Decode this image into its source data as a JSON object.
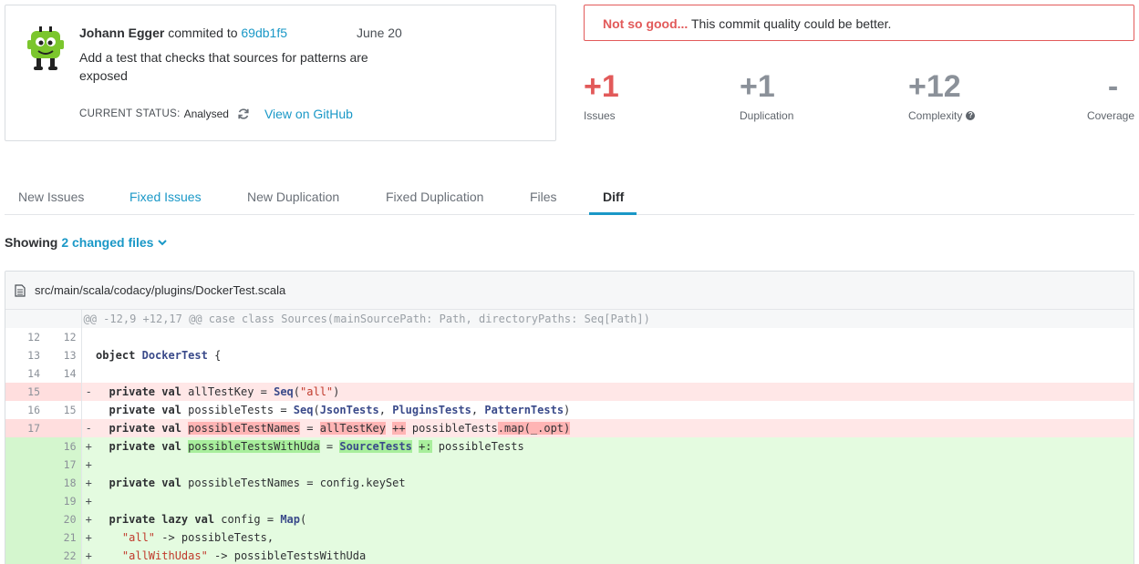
{
  "commit": {
    "author": "Johann Egger",
    "verb": "commited to",
    "sha": "69db1f5",
    "date": "June 20",
    "message": "Add a test that checks that sources for patterns are exposed",
    "status_label": "CURRENT STATUS:",
    "status_value": "Analysed",
    "github_link": "View on GitHub"
  },
  "quality": {
    "headline": "Not so good...",
    "text": " This commit quality could be better.",
    "accent": "#e25a5a"
  },
  "metrics": [
    {
      "value": "+1",
      "label": "Issues"
    },
    {
      "value": "+1",
      "label": "Duplication"
    },
    {
      "value": "+12",
      "label": "Complexity"
    },
    {
      "value": "-",
      "label": "Coverage"
    }
  ],
  "tabs": [
    {
      "label": "New Issues"
    },
    {
      "label": "Fixed Issues"
    },
    {
      "label": "New Duplication"
    },
    {
      "label": "Fixed Duplication"
    },
    {
      "label": "Files"
    },
    {
      "label": "Diff"
    }
  ],
  "showing": {
    "lead": "Showing",
    "files": "2 changed files"
  },
  "diff": {
    "file_path": "src/main/scala/codacy/plugins/DockerTest.scala",
    "hunk_header": "@@ -12,9 +12,17 @@ case class Sources(mainSourcePath: Path, directoryPaths: Seq[Path])",
    "lines": [
      {
        "old": "12",
        "new": "12",
        "sign": ""
      },
      {
        "old": "13",
        "new": "13",
        "sign": ""
      },
      {
        "old": "14",
        "new": "14",
        "sign": ""
      },
      {
        "old": "15",
        "new": "",
        "sign": "-"
      },
      {
        "old": "16",
        "new": "15",
        "sign": ""
      },
      {
        "old": "17",
        "new": "",
        "sign": "-"
      },
      {
        "old": "",
        "new": "16",
        "sign": "+"
      },
      {
        "old": "",
        "new": "17",
        "sign": "+"
      },
      {
        "old": "",
        "new": "18",
        "sign": "+"
      },
      {
        "old": "",
        "new": "19",
        "sign": "+"
      },
      {
        "old": "",
        "new": "20",
        "sign": "+"
      },
      {
        "old": "",
        "new": "21",
        "sign": "+"
      },
      {
        "old": "",
        "new": "22",
        "sign": "+"
      }
    ],
    "tokens": {
      "object_kw": "object",
      "docker_test": "DockerTest",
      "brace_open": " {",
      "private_val": "private val",
      "private_lazy_val": "private lazy val",
      "all_test_key": "allTestKey",
      "eq": " = ",
      "seq": "Seq",
      "all_str": "\"all\"",
      "possible_tests": "possibleTests",
      "json_tests": "JsonTests",
      "plugins_tests": "PluginsTests",
      "pattern_tests": "PatternTests",
      "possible_test_names": "possibleTestNames",
      "plusplus": "++",
      "map_opt": ".map(_.opt)",
      "possible_tests_with_uda": "possibleTestsWithUda",
      "source_tests": "SourceTests",
      "plus_colon": "+:",
      "config_keyset": "config.keySet",
      "config": "config",
      "map_type": "Map",
      "arrow_possible_tests": " -> possibleTests,",
      "all_with_udas_str": "\"allWithUdas\"",
      "arrow_possible_tests_with_uda": " -> possibleTestsWithUda"
    }
  }
}
